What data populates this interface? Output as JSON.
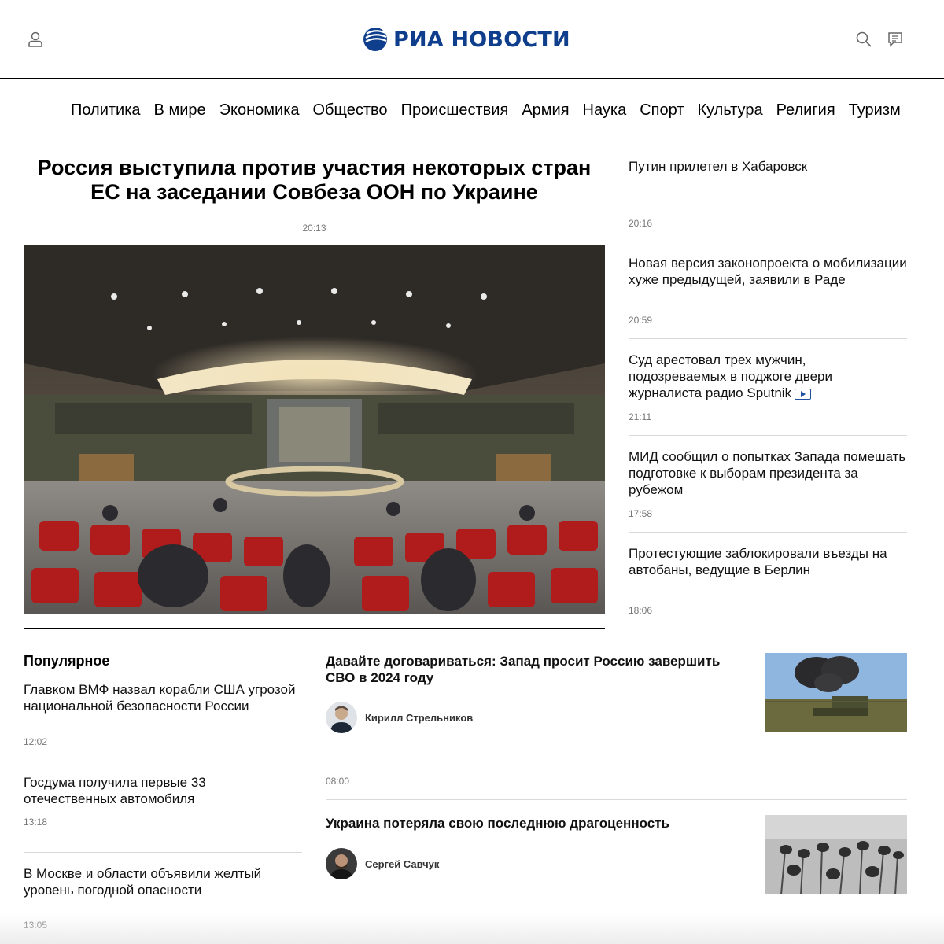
{
  "header": {
    "logo_text": "РИА НОВОСТИ",
    "brand_color": "#0f3f8c",
    "icons": [
      "user-icon",
      "search-icon",
      "comments-icon"
    ]
  },
  "nav": {
    "items": [
      "Политика",
      "В мире",
      "Экономика",
      "Общество",
      "Происшествия",
      "Армия",
      "Наука",
      "Спорт",
      "Культура",
      "Религия",
      "Туризм"
    ]
  },
  "main_story": {
    "title": "Россия выступила против участия некоторых стран ЕС на заседании Совбеза ООН по Украине",
    "time": "20:13"
  },
  "feed": {
    "items": [
      {
        "title": "Путин прилетел в Хабаровск",
        "time": "20:16",
        "video": false
      },
      {
        "title": "Новая версия законопроекта о мобилизации хуже предыдущей, заявили в Раде",
        "time": "20:59",
        "video": false
      },
      {
        "title": "Суд арестовал трех мужчин, подозреваемых в поджоге двери журналиста радио Sputnik",
        "time": "21:11",
        "video": true
      },
      {
        "title": "МИД сообщил о попытках Запада помешать подготовке к выборам президента за рубежом",
        "time": "17:58",
        "video": false
      },
      {
        "title": "Протестующие заблокировали въезды на автобаны, ведущие в Берлин",
        "time": "18:06",
        "video": false
      }
    ]
  },
  "popular": {
    "heading": "Популярное",
    "items": [
      {
        "title": "Главком ВМФ назвал корабли США угрозой национальной безопасности России",
        "time": "12:02"
      },
      {
        "title": "Госдума получила первые 33 отечественных автомобиля",
        "time": "13:18"
      },
      {
        "title": "В Москве и области объявили желтый уровень погодной опасности",
        "time": "13:05"
      }
    ]
  },
  "opinions": {
    "items": [
      {
        "title": "Давайте договариваться: Запад просит Россию завершить СВО в 2024 году",
        "author": "Кирилл Стрельников",
        "time": "08:00"
      },
      {
        "title": "Украина потеряла свою последнюю драгоценность",
        "author": "Сергей Савчук",
        "time": ""
      }
    ]
  }
}
